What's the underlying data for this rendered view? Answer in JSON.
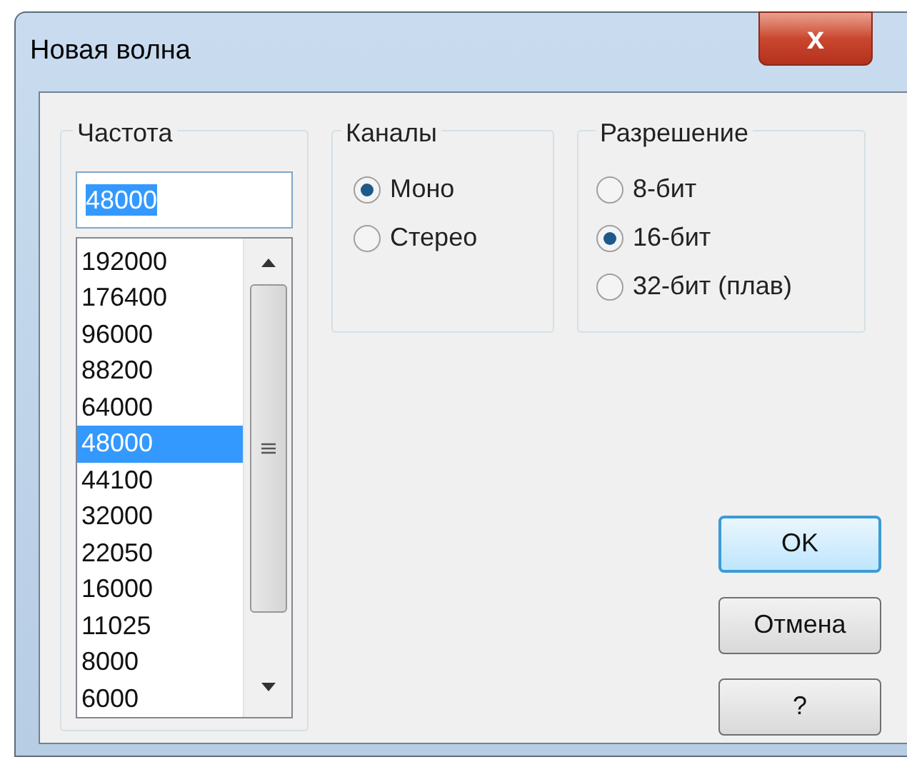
{
  "window": {
    "title": "Новая волна",
    "close": "x"
  },
  "frequency": {
    "legend": "Частота",
    "value": "48000",
    "items": [
      {
        "label": "192000",
        "selected": false
      },
      {
        "label": "176400",
        "selected": false
      },
      {
        "label": "96000",
        "selected": false
      },
      {
        "label": "88200",
        "selected": false
      },
      {
        "label": "64000",
        "selected": false
      },
      {
        "label": "48000",
        "selected": true
      },
      {
        "label": "44100",
        "selected": false
      },
      {
        "label": "32000",
        "selected": false
      },
      {
        "label": "22050",
        "selected": false
      },
      {
        "label": "16000",
        "selected": false
      },
      {
        "label": "11025",
        "selected": false
      },
      {
        "label": "8000",
        "selected": false
      },
      {
        "label": "6000",
        "selected": false
      }
    ]
  },
  "channels": {
    "legend": "Каналы",
    "options": [
      {
        "label": "Моно",
        "selected": true
      },
      {
        "label": "Стерео",
        "selected": false
      }
    ]
  },
  "resolution": {
    "legend": "Разрешение",
    "options": [
      {
        "label": "8-бит",
        "selected": false
      },
      {
        "label": "16-бит",
        "selected": true
      },
      {
        "label": "32-бит (плав)",
        "selected": false
      }
    ]
  },
  "buttons": [
    {
      "label": "OK",
      "default": true
    },
    {
      "label": "Отмена",
      "default": false
    },
    {
      "label": "?",
      "default": false
    }
  ]
}
